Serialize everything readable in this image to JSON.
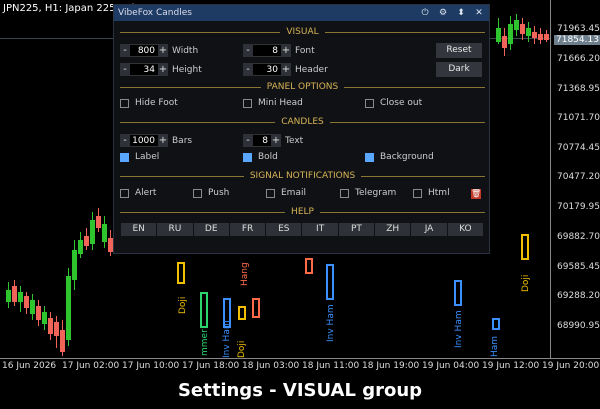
{
  "chart": {
    "title": "JPN225, H1:  Japan 225 Ind",
    "y_labels": [
      "71963.45",
      "71854.13",
      "71666.20",
      "71368.95",
      "71071.70",
      "70774.45",
      "70477.20",
      "70179.95",
      "69882.70",
      "69585.45",
      "69288.20",
      "68990.95"
    ],
    "x_labels": [
      "16 Jun 2026",
      "17 Jun 02:00",
      "17 Jun 10:00",
      "17 Jun 18:00",
      "18 Jun 03:00",
      "18 Jun 11:00",
      "18 Jun 19:00",
      "19 Jun 04:00",
      "19 Jun 12:00",
      "19 Jun 20:00"
    ],
    "pattern_labels": [
      "Doji",
      "mmer",
      "Inv Ham",
      "Doji",
      "Hang",
      "Inv Ham",
      "Inv Ham",
      "Ham",
      "Doji"
    ],
    "colors": {
      "bull": "#2ec52e",
      "bear": "#f0645a",
      "doji": "#f0c000",
      "hammer": "#2dd36f",
      "inv_hammer": "#3b8fff",
      "hanging": "#ff6b4a"
    }
  },
  "panel": {
    "title": "VibeFox Candles",
    "titlebar_icons": [
      "power-icon",
      "gear-icon",
      "pin-icon",
      "close-icon"
    ],
    "sections": {
      "visual": "VISUAL",
      "panel_options": "PANEL OPTIONS",
      "candles": "CANDLES",
      "signal": "SIGNAL NOTIFICATIONS",
      "help": "HELP"
    },
    "visual": {
      "width_value": "800",
      "width_label": "Width",
      "height_value": "34",
      "height_label": "Height",
      "font_value": "8",
      "font_label": "Font",
      "header_value": "30",
      "header_label": "Header",
      "reset_label": "Reset",
      "dark_label": "Dark"
    },
    "panel_options": {
      "hide_foot": "Hide Foot",
      "mini_head": "Mini Head",
      "close_out": "Close out"
    },
    "candles": {
      "bars_value": "1000",
      "bars_label": "Bars",
      "text_value": "8",
      "text_label": "Text",
      "label": "Label",
      "bold": "Bold",
      "background": "Background"
    },
    "signal": {
      "alert": "Alert",
      "push": "Push",
      "email": "Email",
      "telegram": "Telegram",
      "html": "Html"
    },
    "languages": [
      "EN",
      "RU",
      "DE",
      "FR",
      "ES",
      "IT",
      "PT",
      "ZH",
      "JA",
      "KO"
    ]
  },
  "caption": "Settings - VISUAL group"
}
